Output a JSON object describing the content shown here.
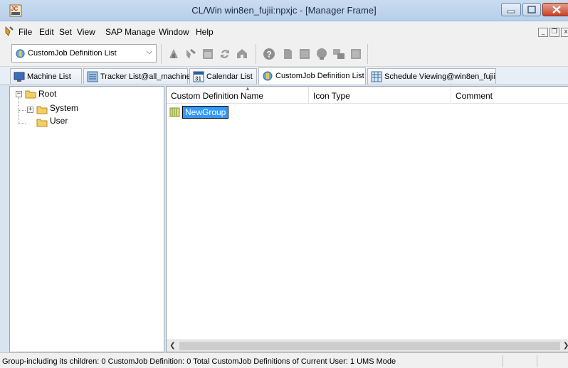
{
  "window": {
    "title": "CL/Win win8en_fujii:npxjc - [Manager Frame]",
    "app_icon": "app-logo-icon",
    "accent": "#3399ff"
  },
  "menu": {
    "items": [
      "File",
      "Edit",
      "Set",
      "View",
      "SAP Manage",
      "Window",
      "Help"
    ],
    "mdi_controls": [
      "_",
      "̅̅❐",
      "x"
    ]
  },
  "toolbar": {
    "view_select": {
      "value": "CustomJob Definition List",
      "icon": "customjob-icon"
    },
    "buttons": [
      "machine-icon",
      "tracker-icon",
      "calendar-icon",
      "refresh-icon",
      "home-icon",
      "help-icon",
      "document-icon",
      "list-icon",
      "customjob-icon",
      "sap-icon",
      "grid-icon"
    ]
  },
  "tabs": [
    {
      "label": "Machine List",
      "icon": "monitor-icon",
      "active": false
    },
    {
      "label": "Tracker List@all_machine",
      "icon": "tracker-icon",
      "active": false
    },
    {
      "label": "Calendar List",
      "icon": "calendar-icon",
      "active": false
    },
    {
      "label": "CustomJob Definition List",
      "icon": "customjob-icon",
      "active": true
    },
    {
      "label": "Schedule Viewing@win8en_fujii",
      "icon": "schedule-icon",
      "active": false
    }
  ],
  "tree": {
    "root": {
      "label": "Root",
      "expanded": true
    },
    "children": [
      {
        "label": "System",
        "expanded": false
      },
      {
        "label": "User",
        "expanded": false
      }
    ]
  },
  "list": {
    "columns": [
      "Custom Definition Name",
      "Icon Type",
      "Comment"
    ],
    "rows": [
      {
        "name": "NewGroup",
        "icon_type": "",
        "comment": "",
        "selected": true,
        "editing": true
      }
    ]
  },
  "status": {
    "text": "Group-including its children: 0   CustomJob Definition: 0   Total CustomJob Definitions of Current User: 1     UMS Mode"
  }
}
